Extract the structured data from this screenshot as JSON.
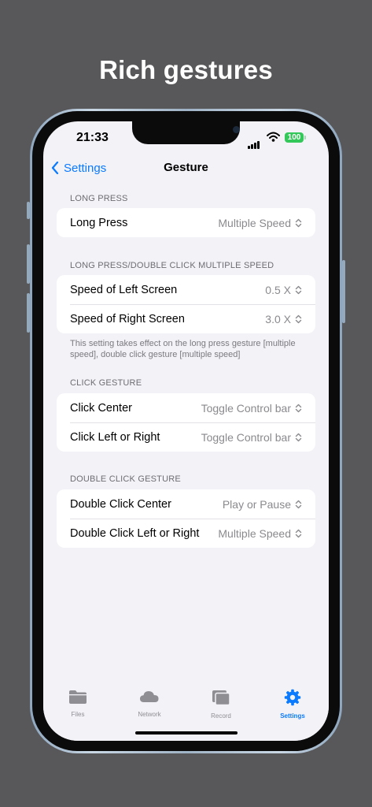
{
  "promo": {
    "title": "Rich gestures"
  },
  "status_bar": {
    "time": "21:33",
    "battery": "100"
  },
  "nav": {
    "back_label": "Settings",
    "title": "Gesture"
  },
  "sections": [
    {
      "header": "LONG PRESS",
      "rows": [
        {
          "label": "Long Press",
          "value": "Multiple Speed"
        }
      ]
    },
    {
      "header": "LONG PRESS/DOUBLE CLICK MULTIPLE SPEED",
      "rows": [
        {
          "label": "Speed of Left Screen",
          "value": "0.5 X"
        },
        {
          "label": "Speed of Right Screen",
          "value": "3.0 X"
        }
      ],
      "footnote": "This setting takes effect on the long press gesture [multiple speed], double click gesture [multiple speed]"
    },
    {
      "header": "CLICK GESTURE",
      "rows": [
        {
          "label": "Click Center",
          "value": "Toggle Control bar"
        },
        {
          "label": "Click Left or Right",
          "value": "Toggle Control bar"
        }
      ]
    },
    {
      "header": "DOUBLE CLICK GESTURE",
      "rows": [
        {
          "label": "Double Click Center",
          "value": "Play or Pause"
        },
        {
          "label": "Double Click Left or Right",
          "value": "Multiple Speed"
        }
      ]
    }
  ],
  "tabbar": {
    "tabs": [
      {
        "label": "Files",
        "icon": "folder-icon"
      },
      {
        "label": "Network",
        "icon": "cloud-icon"
      },
      {
        "label": "Record",
        "icon": "record-stack-icon"
      },
      {
        "label": "Settings",
        "icon": "gear-icon",
        "active": true
      }
    ]
  },
  "colors": {
    "accent": "#0a7aff",
    "battery": "#34c759",
    "background": "#f2f2f7"
  }
}
